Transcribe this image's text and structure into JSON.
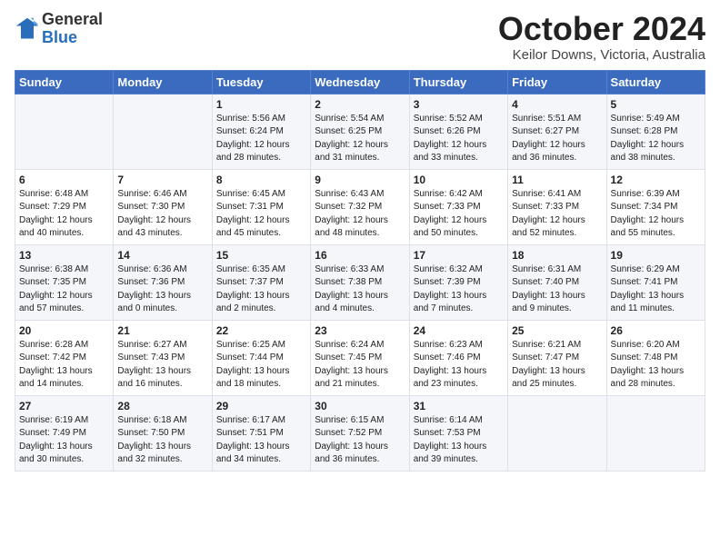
{
  "logo": {
    "general": "General",
    "blue": "Blue"
  },
  "header": {
    "month": "October 2024",
    "location": "Keilor Downs, Victoria, Australia"
  },
  "weekdays": [
    "Sunday",
    "Monday",
    "Tuesday",
    "Wednesday",
    "Thursday",
    "Friday",
    "Saturday"
  ],
  "weeks": [
    [
      {
        "day": "",
        "info": ""
      },
      {
        "day": "",
        "info": ""
      },
      {
        "day": "1",
        "info": "Sunrise: 5:56 AM\nSunset: 6:24 PM\nDaylight: 12 hours\nand 28 minutes."
      },
      {
        "day": "2",
        "info": "Sunrise: 5:54 AM\nSunset: 6:25 PM\nDaylight: 12 hours\nand 31 minutes."
      },
      {
        "day": "3",
        "info": "Sunrise: 5:52 AM\nSunset: 6:26 PM\nDaylight: 12 hours\nand 33 minutes."
      },
      {
        "day": "4",
        "info": "Sunrise: 5:51 AM\nSunset: 6:27 PM\nDaylight: 12 hours\nand 36 minutes."
      },
      {
        "day": "5",
        "info": "Sunrise: 5:49 AM\nSunset: 6:28 PM\nDaylight: 12 hours\nand 38 minutes."
      }
    ],
    [
      {
        "day": "6",
        "info": "Sunrise: 6:48 AM\nSunset: 7:29 PM\nDaylight: 12 hours\nand 40 minutes."
      },
      {
        "day": "7",
        "info": "Sunrise: 6:46 AM\nSunset: 7:30 PM\nDaylight: 12 hours\nand 43 minutes."
      },
      {
        "day": "8",
        "info": "Sunrise: 6:45 AM\nSunset: 7:31 PM\nDaylight: 12 hours\nand 45 minutes."
      },
      {
        "day": "9",
        "info": "Sunrise: 6:43 AM\nSunset: 7:32 PM\nDaylight: 12 hours\nand 48 minutes."
      },
      {
        "day": "10",
        "info": "Sunrise: 6:42 AM\nSunset: 7:33 PM\nDaylight: 12 hours\nand 50 minutes."
      },
      {
        "day": "11",
        "info": "Sunrise: 6:41 AM\nSunset: 7:33 PM\nDaylight: 12 hours\nand 52 minutes."
      },
      {
        "day": "12",
        "info": "Sunrise: 6:39 AM\nSunset: 7:34 PM\nDaylight: 12 hours\nand 55 minutes."
      }
    ],
    [
      {
        "day": "13",
        "info": "Sunrise: 6:38 AM\nSunset: 7:35 PM\nDaylight: 12 hours\nand 57 minutes."
      },
      {
        "day": "14",
        "info": "Sunrise: 6:36 AM\nSunset: 7:36 PM\nDaylight: 13 hours\nand 0 minutes."
      },
      {
        "day": "15",
        "info": "Sunrise: 6:35 AM\nSunset: 7:37 PM\nDaylight: 13 hours\nand 2 minutes."
      },
      {
        "day": "16",
        "info": "Sunrise: 6:33 AM\nSunset: 7:38 PM\nDaylight: 13 hours\nand 4 minutes."
      },
      {
        "day": "17",
        "info": "Sunrise: 6:32 AM\nSunset: 7:39 PM\nDaylight: 13 hours\nand 7 minutes."
      },
      {
        "day": "18",
        "info": "Sunrise: 6:31 AM\nSunset: 7:40 PM\nDaylight: 13 hours\nand 9 minutes."
      },
      {
        "day": "19",
        "info": "Sunrise: 6:29 AM\nSunset: 7:41 PM\nDaylight: 13 hours\nand 11 minutes."
      }
    ],
    [
      {
        "day": "20",
        "info": "Sunrise: 6:28 AM\nSunset: 7:42 PM\nDaylight: 13 hours\nand 14 minutes."
      },
      {
        "day": "21",
        "info": "Sunrise: 6:27 AM\nSunset: 7:43 PM\nDaylight: 13 hours\nand 16 minutes."
      },
      {
        "day": "22",
        "info": "Sunrise: 6:25 AM\nSunset: 7:44 PM\nDaylight: 13 hours\nand 18 minutes."
      },
      {
        "day": "23",
        "info": "Sunrise: 6:24 AM\nSunset: 7:45 PM\nDaylight: 13 hours\nand 21 minutes."
      },
      {
        "day": "24",
        "info": "Sunrise: 6:23 AM\nSunset: 7:46 PM\nDaylight: 13 hours\nand 23 minutes."
      },
      {
        "day": "25",
        "info": "Sunrise: 6:21 AM\nSunset: 7:47 PM\nDaylight: 13 hours\nand 25 minutes."
      },
      {
        "day": "26",
        "info": "Sunrise: 6:20 AM\nSunset: 7:48 PM\nDaylight: 13 hours\nand 28 minutes."
      }
    ],
    [
      {
        "day": "27",
        "info": "Sunrise: 6:19 AM\nSunset: 7:49 PM\nDaylight: 13 hours\nand 30 minutes."
      },
      {
        "day": "28",
        "info": "Sunrise: 6:18 AM\nSunset: 7:50 PM\nDaylight: 13 hours\nand 32 minutes."
      },
      {
        "day": "29",
        "info": "Sunrise: 6:17 AM\nSunset: 7:51 PM\nDaylight: 13 hours\nand 34 minutes."
      },
      {
        "day": "30",
        "info": "Sunrise: 6:15 AM\nSunset: 7:52 PM\nDaylight: 13 hours\nand 36 minutes."
      },
      {
        "day": "31",
        "info": "Sunrise: 6:14 AM\nSunset: 7:53 PM\nDaylight: 13 hours\nand 39 minutes."
      },
      {
        "day": "",
        "info": ""
      },
      {
        "day": "",
        "info": ""
      }
    ]
  ]
}
